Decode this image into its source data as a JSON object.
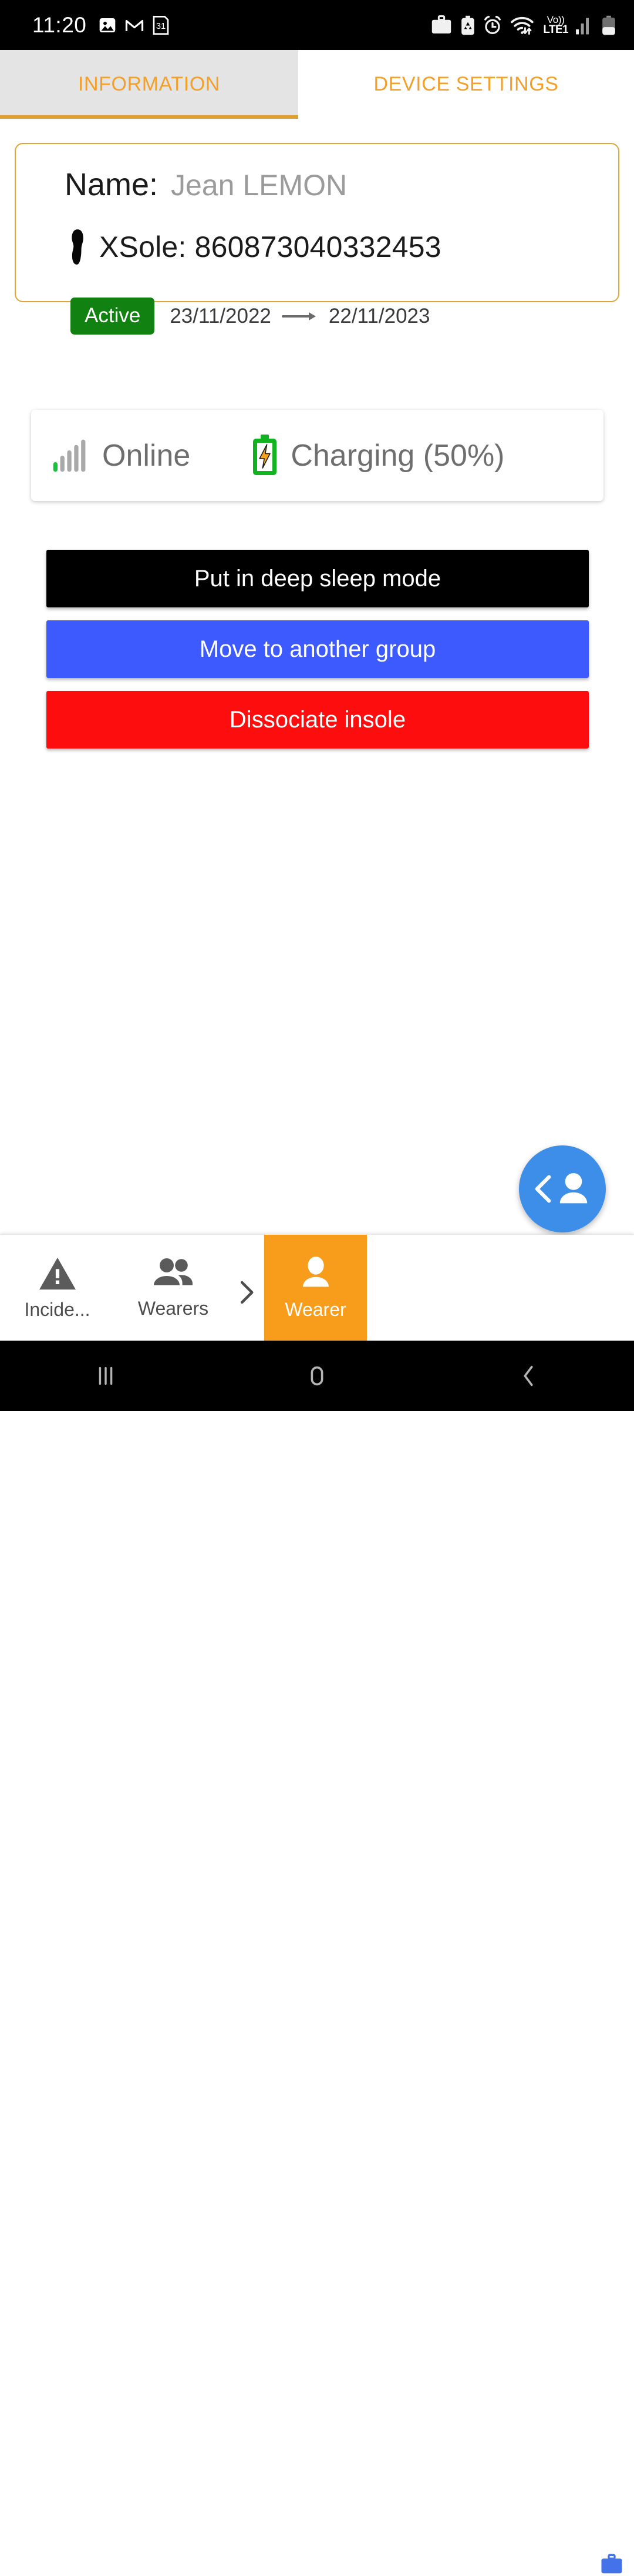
{
  "status_bar": {
    "time": "11:20",
    "left_icons": [
      "photo-icon",
      "gmail-icon",
      "calendar-31-icon"
    ],
    "right_icons": [
      "briefcase-icon",
      "battery-recycle-icon",
      "alarm-icon",
      "wifi-icon"
    ],
    "network": {
      "volte_top": "Vo))",
      "volte_bottom": "LTE1"
    }
  },
  "tabs": [
    {
      "label": "INFORMATION",
      "active": true
    },
    {
      "label": "DEVICE SETTINGS",
      "active": false
    }
  ],
  "info_card": {
    "name_label": "Name:",
    "name_value": "Jean LEMON",
    "xsole_text": "XSole: 860873040332453",
    "insole_icon": "insole-footprint-icon",
    "status_badge": "Active",
    "date_start": "23/11/2022",
    "date_end": "22/11/2023",
    "arrow_icon": "arrow-right-icon"
  },
  "device_status": {
    "connectivity_icon": "signal-bars-icon",
    "connectivity": "Online",
    "battery_icon": "battery-charging-icon",
    "battery": "Charging (50%)"
  },
  "actions": [
    {
      "label": "Put in deep sleep mode",
      "color": "#000000"
    },
    {
      "label": "Move to another group",
      "color": "#3d5afe"
    },
    {
      "label": "Dissociate insole",
      "color": "#fd0d0d"
    }
  ],
  "fab": {
    "icon": "back-person-icon",
    "color": "#3d8ee8"
  },
  "bottom_nav": {
    "items": [
      {
        "label": "Incide...",
        "icon": "warning-triangle-icon",
        "active": false
      },
      {
        "label": "Wearers",
        "icon": "people-group-icon",
        "active": false
      },
      {
        "label": "Wearer",
        "icon": "person-icon",
        "active": true
      }
    ],
    "separator_icon": "chevron-right-icon",
    "corner_icon": "work-briefcase-icon",
    "active_color": "#f89c1c"
  },
  "android_nav": {
    "recents": "recents-icon",
    "home": "home-icon",
    "back": "back-icon"
  }
}
